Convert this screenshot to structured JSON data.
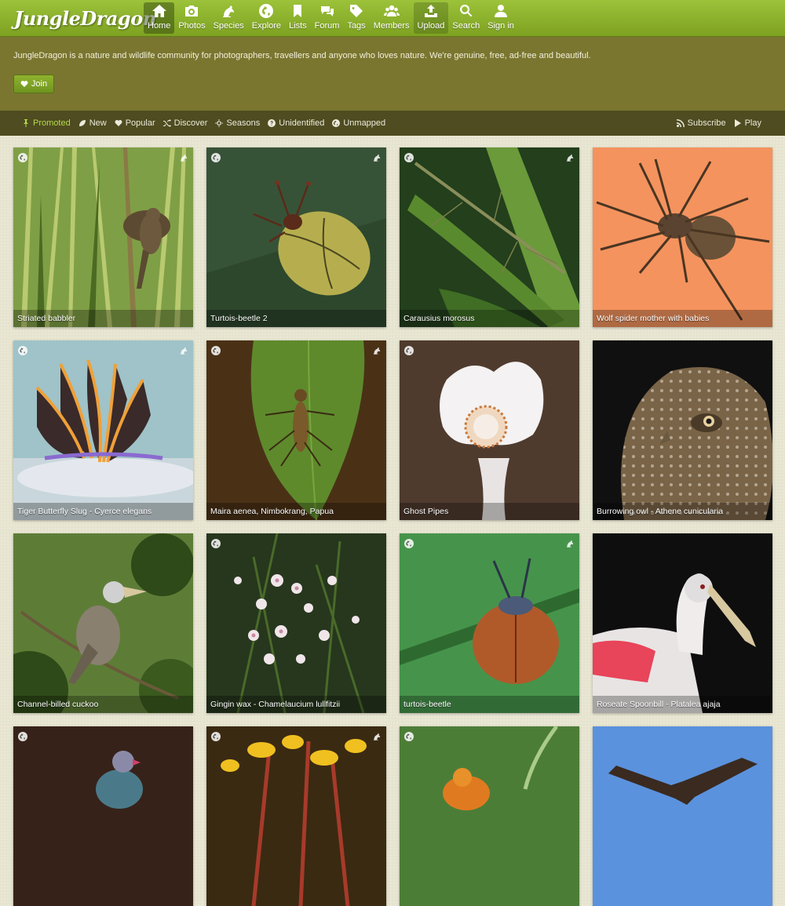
{
  "brand": {
    "name": "JungleDragon"
  },
  "nav": [
    {
      "label": "Home",
      "icon": "home-icon"
    },
    {
      "label": "Photos",
      "icon": "camera-icon"
    },
    {
      "label": "Species",
      "icon": "species-icon"
    },
    {
      "label": "Explore",
      "icon": "globe-icon"
    },
    {
      "label": "Lists",
      "icon": "bookmark-icon"
    },
    {
      "label": "Forum",
      "icon": "comments-icon"
    },
    {
      "label": "Tags",
      "icon": "tag-icon"
    },
    {
      "label": "Members",
      "icon": "users-icon"
    },
    {
      "label": "Upload",
      "icon": "upload-icon"
    },
    {
      "label": "Search",
      "icon": "search-icon"
    },
    {
      "label": "Sign in",
      "icon": "user-icon"
    }
  ],
  "hero": {
    "tagline": "JungleDragon is a nature and wildlife community for photographers, travellers and anyone who loves nature. We're genuine, free, ad-free and beautiful.",
    "join_label": "Join"
  },
  "filters": [
    {
      "label": "Promoted",
      "icon": "pin-icon"
    },
    {
      "label": "New",
      "icon": "leaf-icon"
    },
    {
      "label": "Popular",
      "icon": "heart-icon"
    },
    {
      "label": "Discover",
      "icon": "shuffle-icon"
    },
    {
      "label": "Seasons",
      "icon": "sun-icon"
    },
    {
      "label": "Unidentified",
      "icon": "question-icon"
    },
    {
      "label": "Unmapped",
      "icon": "globe-icon"
    }
  ],
  "filters_right": [
    {
      "label": "Subscribe",
      "icon": "rss-icon"
    },
    {
      "label": "Play",
      "icon": "play-icon"
    }
  ],
  "photos": [
    {
      "caption": "Striated babbler"
    },
    {
      "caption": "Turtois-beetle 2"
    },
    {
      "caption": "Carausius morosus"
    },
    {
      "caption": "Wolf spider mother with babies"
    },
    {
      "caption": "Tiger Butterfly Slug - Cyerce elegans"
    },
    {
      "caption": "Maira aenea, Nimbokrang, Papua"
    },
    {
      "caption": "Ghost Pipes"
    },
    {
      "caption": "Burrowing owl - Athene cunicularia"
    },
    {
      "caption": "Channel-billed cuckoo"
    },
    {
      "caption": "Gingin wax - Chamelaucium lullfitzii"
    },
    {
      "caption": "turtois-beetle"
    },
    {
      "caption": "Roseate Spoonbill - Platalea ajaja"
    },
    {
      "caption": ""
    },
    {
      "caption": ""
    },
    {
      "caption": ""
    },
    {
      "caption": ""
    }
  ]
}
